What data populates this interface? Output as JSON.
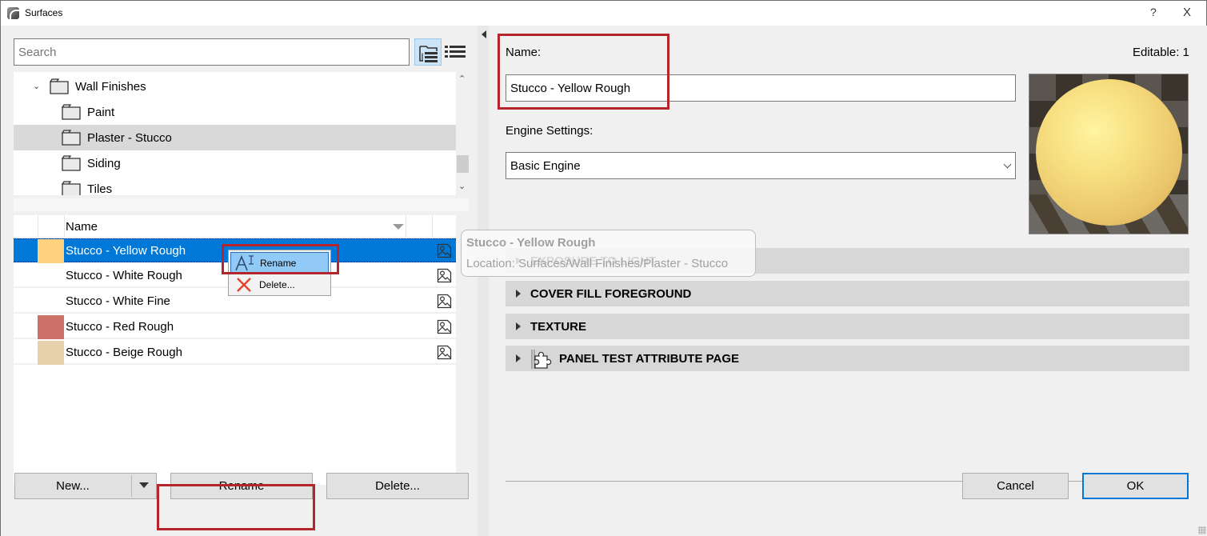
{
  "window": {
    "title": "Surfaces",
    "help_label": "?",
    "close_label": "X"
  },
  "search": {
    "placeholder": "Search",
    "value": ""
  },
  "view_buttons": [
    {
      "name": "tree-view",
      "icon": "folder-tree-icon",
      "active": true
    },
    {
      "name": "list-view",
      "icon": "list-icon",
      "active": false
    }
  ],
  "tree": {
    "items": [
      {
        "label": "Wall Finishes",
        "level": 0,
        "expanded": true,
        "selected": false
      },
      {
        "label": "Paint",
        "level": 1,
        "selected": false
      },
      {
        "label": "Plaster - Stucco",
        "level": 1,
        "selected": true
      },
      {
        "label": "Siding",
        "level": 1,
        "selected": false
      },
      {
        "label": "Tiles",
        "level": 1,
        "selected": false
      }
    ]
  },
  "list": {
    "header": {
      "name": "Name"
    },
    "rows": [
      {
        "name": "Stucco - Yellow Rough",
        "swatch": "#fed27e",
        "selected": true
      },
      {
        "name": "Stucco - White Rough",
        "swatch": "#ffffff",
        "selected": false
      },
      {
        "name": "Stucco - White Fine",
        "swatch": "#ffffff",
        "selected": false
      },
      {
        "name": "Stucco - Red Rough",
        "swatch": "#cd7068",
        "selected": false
      },
      {
        "name": "Stucco - Beige Rough",
        "swatch": "#e7d0ac",
        "selected": false
      }
    ]
  },
  "context_menu": {
    "items": [
      {
        "label": "Rename",
        "icon": "rename-icon",
        "highlighted": true
      },
      {
        "label": "Delete...",
        "icon": "delete-x-icon",
        "highlighted": false
      }
    ]
  },
  "tooltip": {
    "title": "Stucco - Yellow Rough",
    "location": "Location: Surfaces/Wall Finishes/Plaster - Stucco"
  },
  "left_buttons": {
    "new": "New...",
    "rename": "Rename",
    "delete": "Delete..."
  },
  "details": {
    "name_label": "Name:",
    "name_value": "Stucco - Yellow Rough",
    "editable": "Editable: 1",
    "engine_label": "Engine Settings:",
    "engine_value": "Basic Engine"
  },
  "panels": [
    {
      "title": "EXPOSURE TO LIGHT"
    },
    {
      "title": "COVER FILL FOREGROUND"
    },
    {
      "title": "TEXTURE"
    },
    {
      "title": "PANEL TEST ATTRIBUTE PAGE",
      "icon": "puzzle-icon"
    }
  ],
  "footer": {
    "cancel": "Cancel",
    "ok": "OK"
  },
  "colors": {
    "selection": "#0078d7",
    "highlight_box": "#b5262c",
    "menu_highlight": "#91c9f7"
  }
}
